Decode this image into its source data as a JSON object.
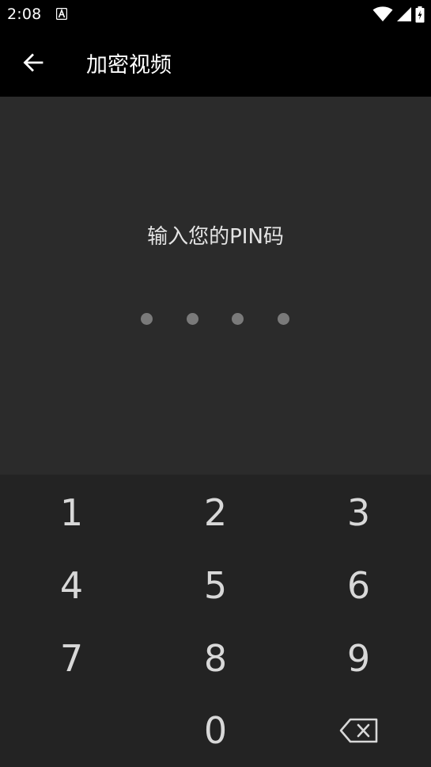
{
  "status_bar": {
    "time": "2:08",
    "notification_icon": "font-a-icon",
    "icons": [
      "wifi-icon",
      "cellular-signal-icon",
      "battery-charging-icon"
    ]
  },
  "app_bar": {
    "back_icon": "arrow-back-icon",
    "title": "加密视频"
  },
  "pin": {
    "prompt": "输入您的PIN码",
    "length": 4,
    "entered": 0
  },
  "keypad": {
    "keys": [
      {
        "label": "1",
        "name": "key-1"
      },
      {
        "label": "2",
        "name": "key-2"
      },
      {
        "label": "3",
        "name": "key-3"
      },
      {
        "label": "4",
        "name": "key-4"
      },
      {
        "label": "5",
        "name": "key-5"
      },
      {
        "label": "6",
        "name": "key-6"
      },
      {
        "label": "7",
        "name": "key-7"
      },
      {
        "label": "8",
        "name": "key-8"
      },
      {
        "label": "9",
        "name": "key-9"
      },
      {
        "label": "0",
        "name": "key-0"
      }
    ],
    "backspace_icon": "backspace-icon"
  },
  "colors": {
    "status_bar": "#000000",
    "app_bar": "#000000",
    "pin_area": "#2b2b2b",
    "keypad": "#232323",
    "dot": "#7a7a7a",
    "key_text": "#d8d8d8"
  }
}
